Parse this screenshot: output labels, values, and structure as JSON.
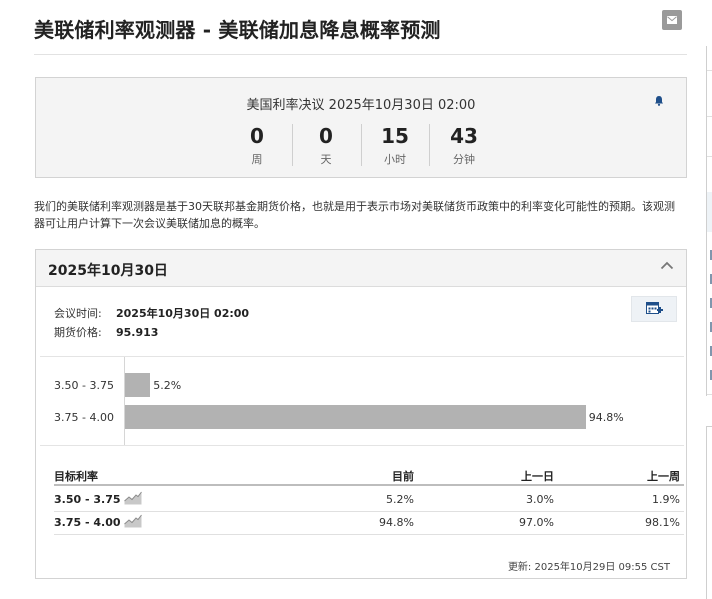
{
  "header": {
    "title": "美联储利率观测器 - 美联储加息降息概率预测"
  },
  "countdown": {
    "title": "美国利率决议 2025年10月30日 02:00",
    "cells": [
      {
        "value": "0",
        "unit": "周"
      },
      {
        "value": "0",
        "unit": "天"
      },
      {
        "value": "15",
        "unit": "小时"
      },
      {
        "value": "43",
        "unit": "分钟"
      }
    ]
  },
  "intro": "我们的美联储利率观测器是基于30天联邦基金期货价格，也就是用于表示市场对美联储货币政策中的利率变化可能性的预期。该观测器可让用户计算下一次会议美联储加息的概率。",
  "meeting": {
    "date_title": "2025年10月30日",
    "meeting_time_label": "会议时间:",
    "meeting_time_value": "2025年10月30日 02:00",
    "futures_price_label": "期货价格:",
    "futures_price_value": "95.913"
  },
  "chart_data": {
    "type": "bar",
    "orientation": "horizontal",
    "categories": [
      "3.50 - 3.75",
      "3.75 - 4.00"
    ],
    "values": [
      5.2,
      94.8
    ],
    "value_labels": [
      "5.2%",
      "94.8%"
    ],
    "xlim": [
      0,
      100
    ]
  },
  "table": {
    "headers": {
      "rate": "目标利率",
      "now": "目前",
      "day": "上一日",
      "week": "上一周"
    },
    "rows": [
      {
        "rate": "3.50 - 3.75",
        "now": "5.2%",
        "day": "3.0%",
        "week": "1.9%"
      },
      {
        "rate": "3.75 - 4.00",
        "now": "94.8%",
        "day": "97.0%",
        "week": "98.1%"
      }
    ]
  },
  "updated": "更新: 2025年10月29日 09:55 CST",
  "colors": {
    "bar": "#b2b2b2",
    "panel_bg": "#f4f4f4",
    "icon_blue": "#1f4f8a"
  },
  "icons": {
    "mail": "mail-icon",
    "bell": "bell-icon",
    "collapse": "chevron-up-icon",
    "calendar": "calendar-add-icon",
    "chart": "sparkline-icon"
  }
}
